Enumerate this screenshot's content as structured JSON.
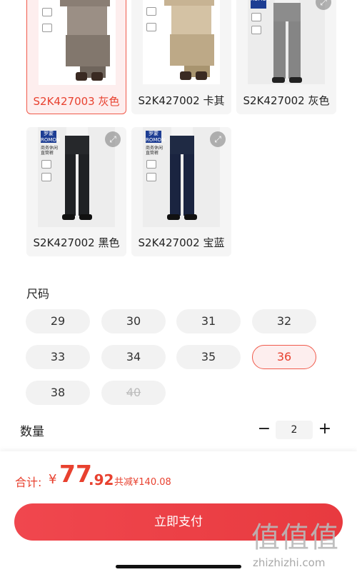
{
  "color_options": [
    {
      "label": "S2K427003 灰色",
      "selected": true,
      "shade": "#8a7e74",
      "zoom_icon": "expand-icon"
    },
    {
      "label": "S2K427002 卡其",
      "selected": false,
      "shade": "#c7b393",
      "zoom_icon": "expand-icon"
    },
    {
      "label": "S2K427002 灰色",
      "selected": false,
      "shade": "#8c8c8c",
      "zoom_icon": "expand-icon"
    },
    {
      "label": "S2K427002 黑色",
      "selected": false,
      "shade": "#26282b",
      "zoom_icon": "expand-icon"
    },
    {
      "label": "S2K427002 宝蓝",
      "selected": false,
      "shade": "#1f2a44",
      "zoom_icon": "expand-icon"
    }
  ],
  "product_tag": {
    "brand": "罗蒙\nROMON",
    "text": "商务休闲\n直筒裤"
  },
  "size_section": {
    "title": "尺码",
    "sizes": [
      {
        "label": "29",
        "state": "normal"
      },
      {
        "label": "30",
        "state": "normal"
      },
      {
        "label": "31",
        "state": "normal"
      },
      {
        "label": "32",
        "state": "normal"
      },
      {
        "label": "33",
        "state": "normal"
      },
      {
        "label": "34",
        "state": "normal"
      },
      {
        "label": "35",
        "state": "normal"
      },
      {
        "label": "36",
        "state": "selected"
      },
      {
        "label": "38",
        "state": "normal"
      },
      {
        "label": "40",
        "state": "disabled"
      }
    ]
  },
  "quantity": {
    "title": "数量",
    "minus": "−",
    "plus": "+",
    "value": "2"
  },
  "footer": {
    "total_label": "合计:",
    "currency": "¥",
    "total_integer": "77",
    "total_decimal": ".92",
    "discount": "共减¥140.08",
    "pay_button": "立即支付"
  },
  "watermark": {
    "hanzi": "值值值",
    "url": "zhizhizhi.com"
  },
  "colors": {
    "accent": "#e8412f",
    "pay_button": "#ee4148",
    "chip_bg": "#f2f2f2"
  }
}
